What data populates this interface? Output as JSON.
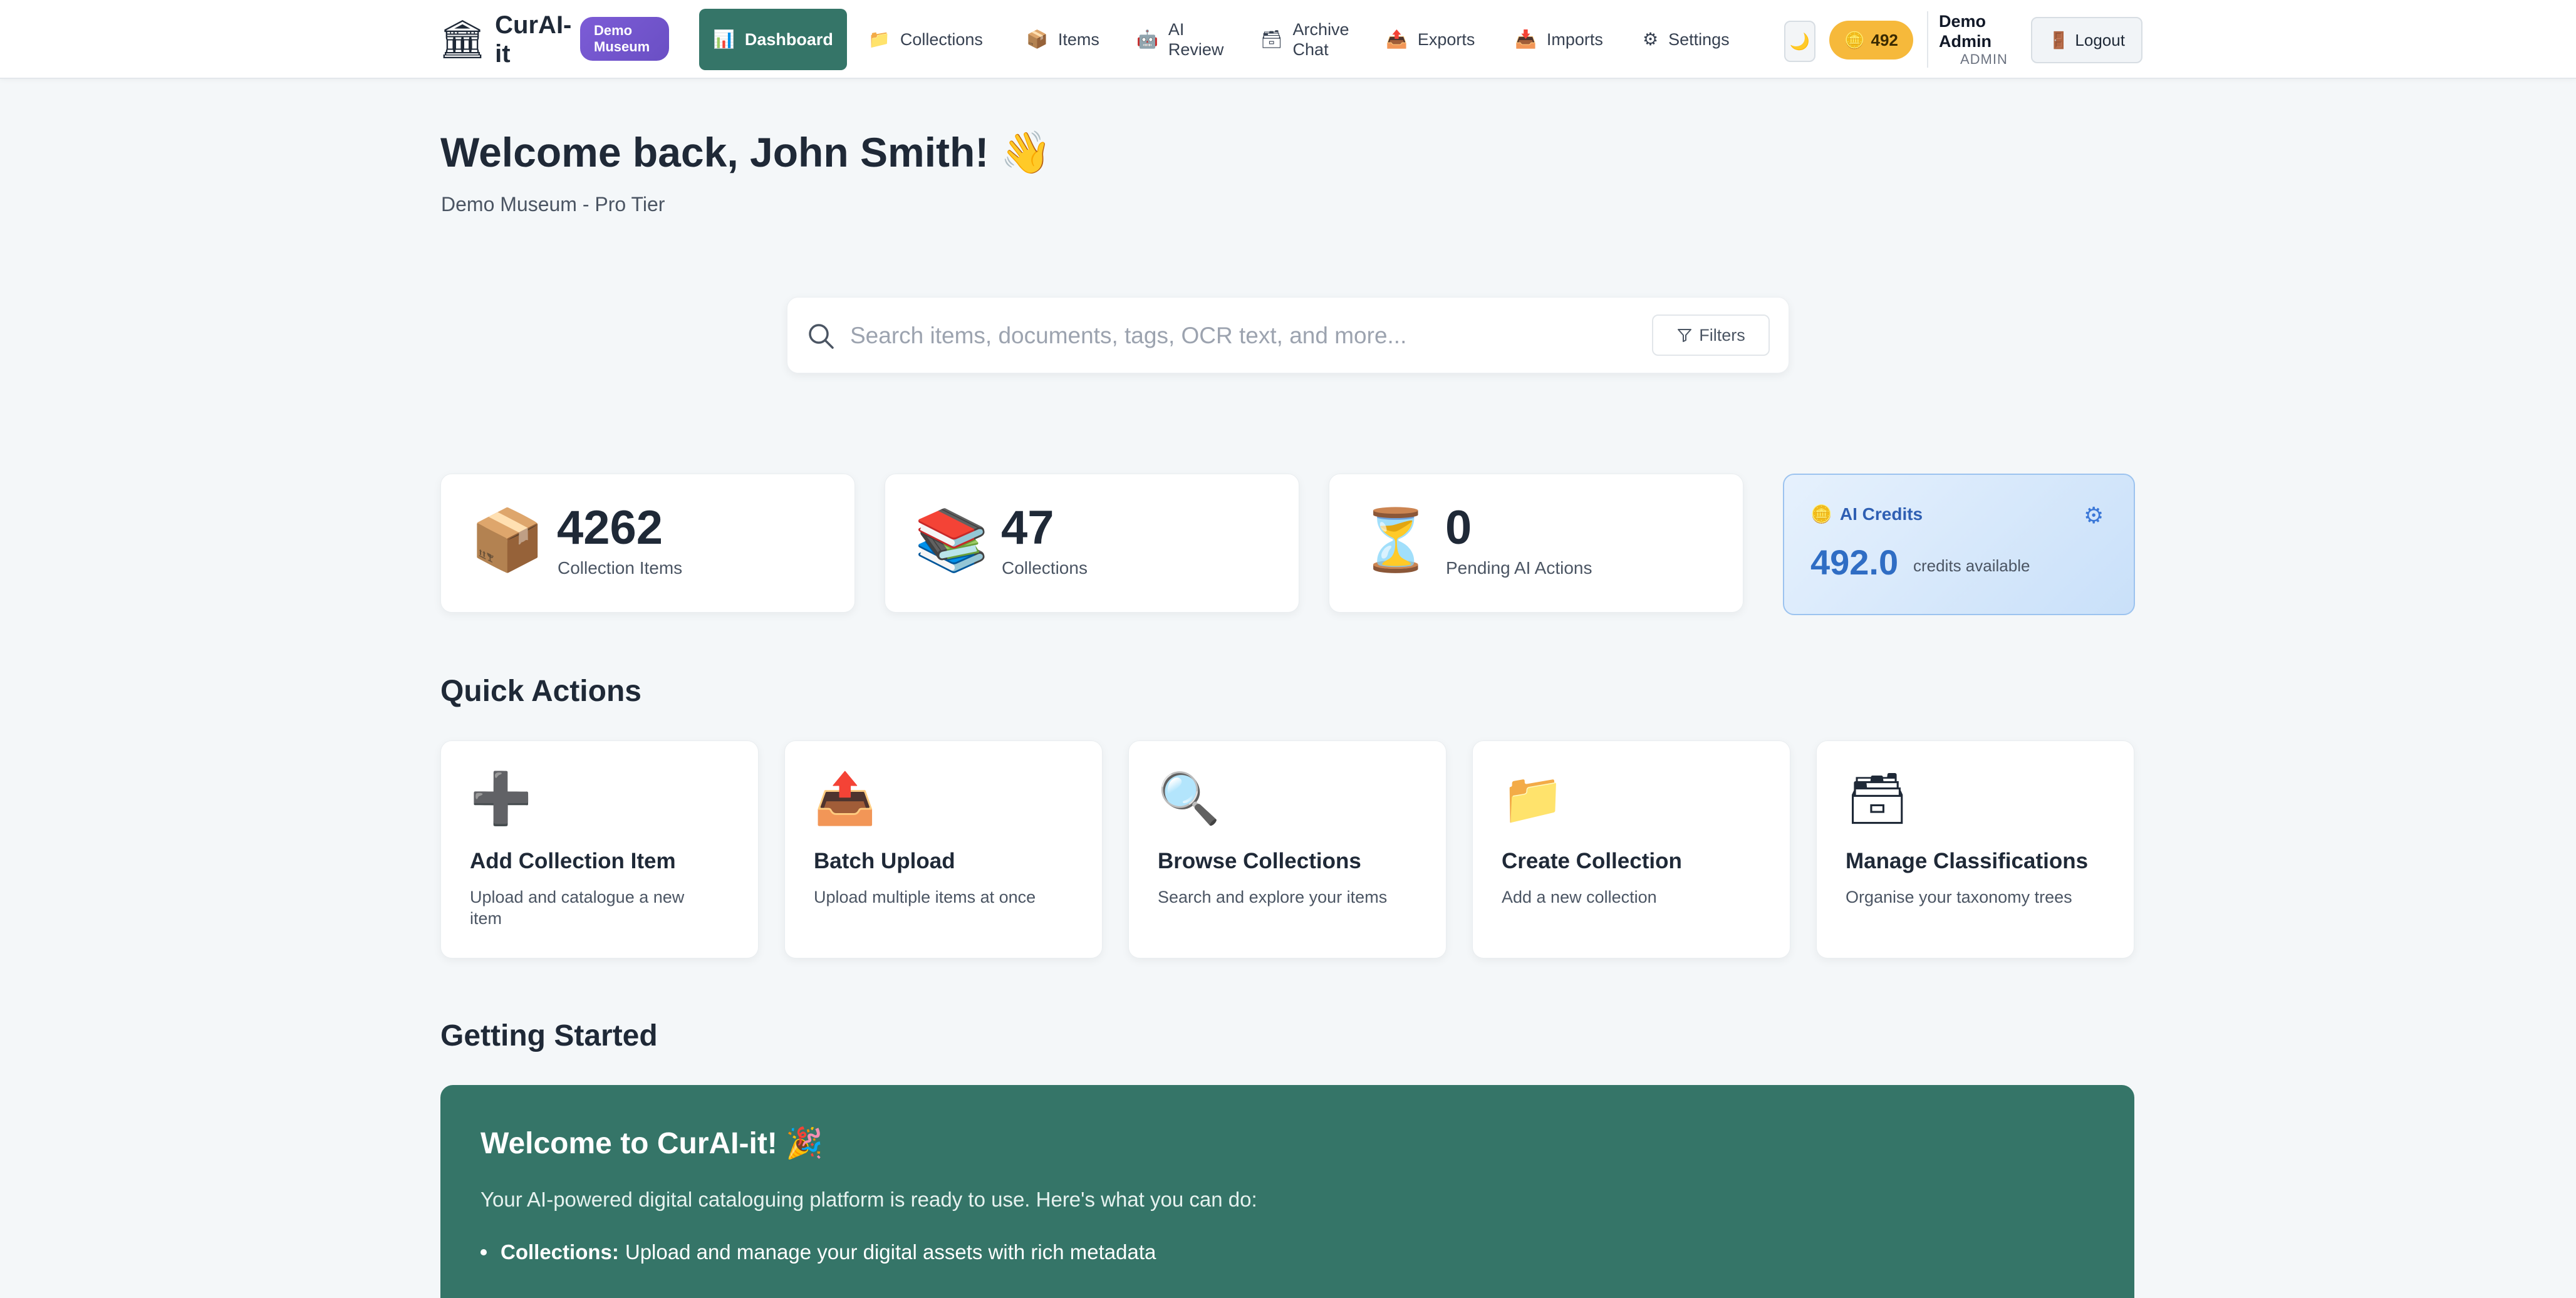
{
  "app": {
    "name": "CurAI-it",
    "tenant_badge": "Demo Museum"
  },
  "nav": {
    "items": [
      {
        "label": "Dashboard",
        "icon": "📊",
        "active": true
      },
      {
        "label": "Collections",
        "icon": "📁"
      },
      {
        "label": "Items",
        "icon": "📦"
      },
      {
        "label": "AI Review",
        "icon": "🤖"
      },
      {
        "label": "Archive Chat",
        "icon": "🗃"
      },
      {
        "label": "Exports",
        "icon": "📤"
      },
      {
        "label": "Imports",
        "icon": "📥"
      },
      {
        "label": "Settings",
        "icon": "⚙"
      }
    ],
    "theme_icon": "🌙",
    "credits_pill": "492",
    "user": {
      "name": "Demo Admin",
      "role": "ADMIN"
    },
    "logout_label": "Logout"
  },
  "header": {
    "welcome": "Welcome back, John Smith! 👋",
    "subtitle": "Demo Museum - Pro Tier"
  },
  "search": {
    "placeholder": "Search items, documents, tags, OCR text, and more...",
    "value": "",
    "filters_label": "Filters"
  },
  "stats": [
    {
      "icon": "📦",
      "value": "4262",
      "label": "Collection Items"
    },
    {
      "icon": "📚",
      "value": "47",
      "label": "Collections"
    },
    {
      "icon": "⏳",
      "value": "0",
      "label": "Pending AI Actions"
    }
  ],
  "ai_credits": {
    "title": "AI Credits",
    "value": "492.0",
    "caption": "credits available"
  },
  "quick_actions": {
    "title": "Quick Actions",
    "items": [
      {
        "icon": "➕",
        "title": "Add Collection Item",
        "desc": "Upload and catalogue a new item"
      },
      {
        "icon": "📤",
        "title": "Batch Upload",
        "desc": "Upload multiple items at once"
      },
      {
        "icon": "🔍",
        "title": "Browse Collections",
        "desc": "Search and explore your items"
      },
      {
        "icon": "📁",
        "title": "Create Collection",
        "desc": "Add a new collection"
      },
      {
        "icon": "🗃",
        "title": "Manage Classifications",
        "desc": "Organise your taxonomy trees"
      }
    ]
  },
  "getting_started": {
    "title": "Getting Started",
    "panel_title": "Welcome to CurAI-it! 🎉",
    "intro": "Your AI-powered digital cataloguing platform is ready to use. Here's what you can do:",
    "bullets": [
      {
        "term": "Collections:",
        "text": "Upload and manage your digital assets with rich metadata"
      }
    ]
  },
  "colors": {
    "primary": "#357568",
    "badge": "#7c5cd6",
    "credits_pill": "#f6b93b",
    "credits_accent": "#2f6dc4",
    "background": "#f4f7f9"
  }
}
